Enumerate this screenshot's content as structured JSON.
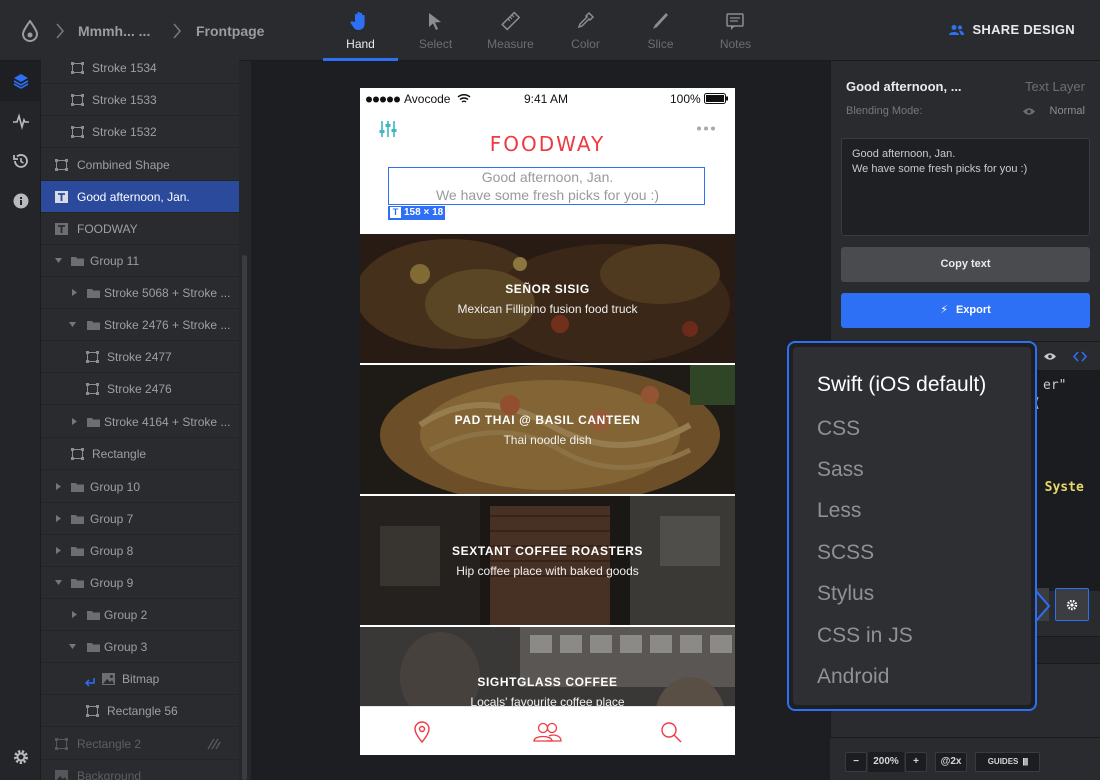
{
  "breadcrumb": {
    "project": "Mmmh... ...",
    "page": "Frontpage"
  },
  "tools": [
    {
      "label": "Hand",
      "icon": "hand-icon"
    },
    {
      "label": "Select",
      "icon": "cursor-icon"
    },
    {
      "label": "Measure",
      "icon": "ruler-icon"
    },
    {
      "label": "Color",
      "icon": "eyedropper-icon"
    },
    {
      "label": "Slice",
      "icon": "knife-icon"
    },
    {
      "label": "Notes",
      "icon": "chat-icon"
    }
  ],
  "share_label": "SHARE DESIGN",
  "layers": [
    {
      "label": "Stroke 1534",
      "kind": "shape"
    },
    {
      "label": "Stroke 1533",
      "kind": "shape"
    },
    {
      "label": "Stroke 1532",
      "kind": "shape"
    },
    {
      "label": "Combined Shape",
      "kind": "shape"
    },
    {
      "label": "Good afternoon, Jan.",
      "kind": "text"
    },
    {
      "label": "FOODWAY",
      "kind": "text"
    },
    {
      "label": "Group 11",
      "kind": "group"
    },
    {
      "label": "Stroke 5068 + Stroke ...",
      "kind": "group"
    },
    {
      "label": "Stroke 2476 + Stroke ...",
      "kind": "group"
    },
    {
      "label": "Stroke 2477",
      "kind": "shape"
    },
    {
      "label": "Stroke 2476",
      "kind": "shape"
    },
    {
      "label": "Stroke 4164 + Stroke ...",
      "kind": "group"
    },
    {
      "label": "Rectangle",
      "kind": "shape"
    },
    {
      "label": "Group 10",
      "kind": "group"
    },
    {
      "label": "Group 7",
      "kind": "group"
    },
    {
      "label": "Group 8",
      "kind": "group"
    },
    {
      "label": "Group 9",
      "kind": "group"
    },
    {
      "label": "Group 2",
      "kind": "group"
    },
    {
      "label": "Group 3",
      "kind": "group"
    },
    {
      "label": "Bitmap",
      "kind": "bitmap"
    },
    {
      "label": "Rectangle 56",
      "kind": "shape"
    },
    {
      "label": "Rectangle 2",
      "kind": "shape"
    },
    {
      "label": "Background",
      "kind": "bitmap"
    }
  ],
  "phone": {
    "carrier": "Avocode",
    "time": "9:41 AM",
    "battery": "100%",
    "brand": "FOODWAY",
    "greeting_1": "Good afternoon, Jan.",
    "greeting_2": "We have some fresh picks for you :)",
    "selection_dims": "158 × 18",
    "cards": [
      {
        "title": "SEÑOR SISIG",
        "subtitle": "Mexican Fillipino fusion food truck"
      },
      {
        "title": "PAD THAI @ BASIL CANTEEN",
        "subtitle": "Thai noodle dish"
      },
      {
        "title": "SEXTANT COFFEE ROASTERS",
        "subtitle": "Hip coffee place with baked goods"
      },
      {
        "title": "SIGHTGLASS COFFEE",
        "subtitle": "Locals' favourite coffee place"
      }
    ]
  },
  "inspector": {
    "layer_name": "Good afternoon, ...",
    "layer_type": "Text Layer",
    "blend_label": "Blending Mode:",
    "blend_value": "Normal",
    "text_line_1": "Good afternoon, Jan.",
    "text_line_2": "We have some fresh picks for you :)",
    "copy_label": "Copy text",
    "export_label": "Export",
    "code_fragments": [
      "er\"",
      "(",
      "e Syste"
    ]
  },
  "code_languages": {
    "selected": "Swift (iOS default)",
    "options": [
      "Swift (iOS default)",
      "CSS",
      "Sass",
      "Less",
      "SCSS",
      "Stylus",
      "CSS in JS",
      "Android"
    ]
  },
  "zoom": {
    "minus": "−",
    "value": "200%",
    "plus": "+",
    "density": "@2x",
    "guides": "GUIDES"
  },
  "colors": {
    "accent": "#2d6ff5",
    "brand": "#ee3a43",
    "selected_layer": "#2b4a9c"
  }
}
